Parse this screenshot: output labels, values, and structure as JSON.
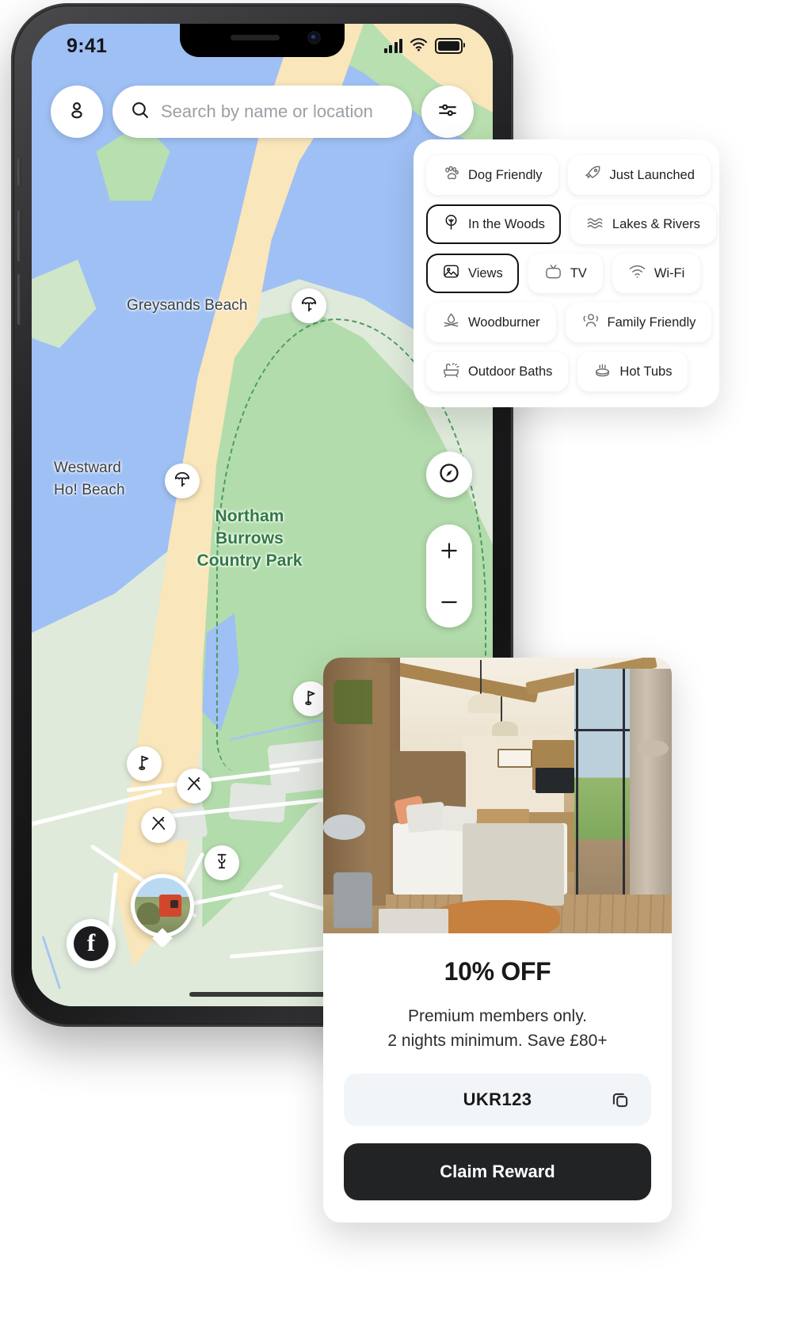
{
  "status_bar": {
    "time": "9:41",
    "signal_icon": "cellular-bars-icon",
    "wifi_icon": "wifi-icon",
    "battery_icon": "battery-icon"
  },
  "search": {
    "profile_icon": "person-icon",
    "search_icon": "search-icon",
    "placeholder": "Search by name or location",
    "value": "",
    "filters_icon": "sliders-icon"
  },
  "map": {
    "labels": [
      {
        "text": "Greysands Beach",
        "style": "grey"
      },
      {
        "text": "Westward",
        "style": "grey"
      },
      {
        "text": "Ho! Beach",
        "style": "grey"
      },
      {
        "text": "Northam",
        "style": "green"
      },
      {
        "text": "Burrows",
        "style": "green"
      },
      {
        "text": "Country Park",
        "style": "green"
      }
    ],
    "markers": [
      {
        "icon": "beach-umbrella-icon",
        "name": "beach-marker-greysands"
      },
      {
        "icon": "beach-umbrella-icon",
        "name": "beach-marker-westward"
      },
      {
        "icon": "golf-flag-icon",
        "name": "golf-marker-upper"
      },
      {
        "icon": "golf-flag-icon",
        "name": "golf-marker-lower"
      },
      {
        "icon": "cutlery-icon",
        "name": "restaurant-marker-1"
      },
      {
        "icon": "cutlery-icon",
        "name": "restaurant-marker-2"
      },
      {
        "icon": "wine-glass-icon",
        "name": "bar-marker"
      },
      {
        "icon": "property-photo",
        "name": "property-pin"
      }
    ],
    "controls": {
      "compass_icon": "compass-icon",
      "zoom_in_label": "+",
      "zoom_out_label": "−",
      "facebook_icon": "facebook-icon",
      "facebook_glyph": "f"
    },
    "colors": {
      "water": "#9fc0f5",
      "sand": "#fae6bb",
      "green_light": "#dfeadb",
      "green_mid": "#b2dcab",
      "park_boundary": "#4a9b5e",
      "label_green": "#2f7a44",
      "label_grey": "#3c4043"
    }
  },
  "filter_panel": {
    "rows": [
      [
        {
          "label": "Dog Friendly",
          "icon": "paw-icon",
          "selected": false
        },
        {
          "label": "Just Launched",
          "icon": "rocket-icon",
          "selected": false
        }
      ],
      [
        {
          "label": "In the Woods",
          "icon": "tree-icon",
          "selected": true
        },
        {
          "label": "Lakes & Rivers",
          "icon": "waves-icon",
          "selected": false
        }
      ],
      [
        {
          "label": "Views",
          "icon": "image-icon",
          "selected": true
        },
        {
          "label": "TV",
          "icon": "tv-icon",
          "selected": false
        },
        {
          "label": "Wi-Fi",
          "icon": "wifi-icon",
          "selected": false
        }
      ],
      [
        {
          "label": "Woodburner",
          "icon": "flame-icon",
          "selected": false
        },
        {
          "label": "Family Friendly",
          "icon": "people-icon",
          "selected": false
        }
      ],
      [
        {
          "label": "Outdoor Baths",
          "icon": "bathtub-icon",
          "selected": false
        },
        {
          "label": "Hot Tubs",
          "icon": "hot-tub-icon",
          "selected": false
        }
      ]
    ]
  },
  "promo_card": {
    "image_alt": "cabin-interior-photo",
    "title": "10% OFF",
    "subtitle_line1": "Premium members only.",
    "subtitle_line2": "2 nights minimum. Save £80+",
    "code": "UKR123",
    "copy_icon": "copy-icon",
    "claim_label": "Claim Reward",
    "colors": {
      "button_bg": "#222325",
      "code_bg": "#f1f5f8"
    }
  }
}
